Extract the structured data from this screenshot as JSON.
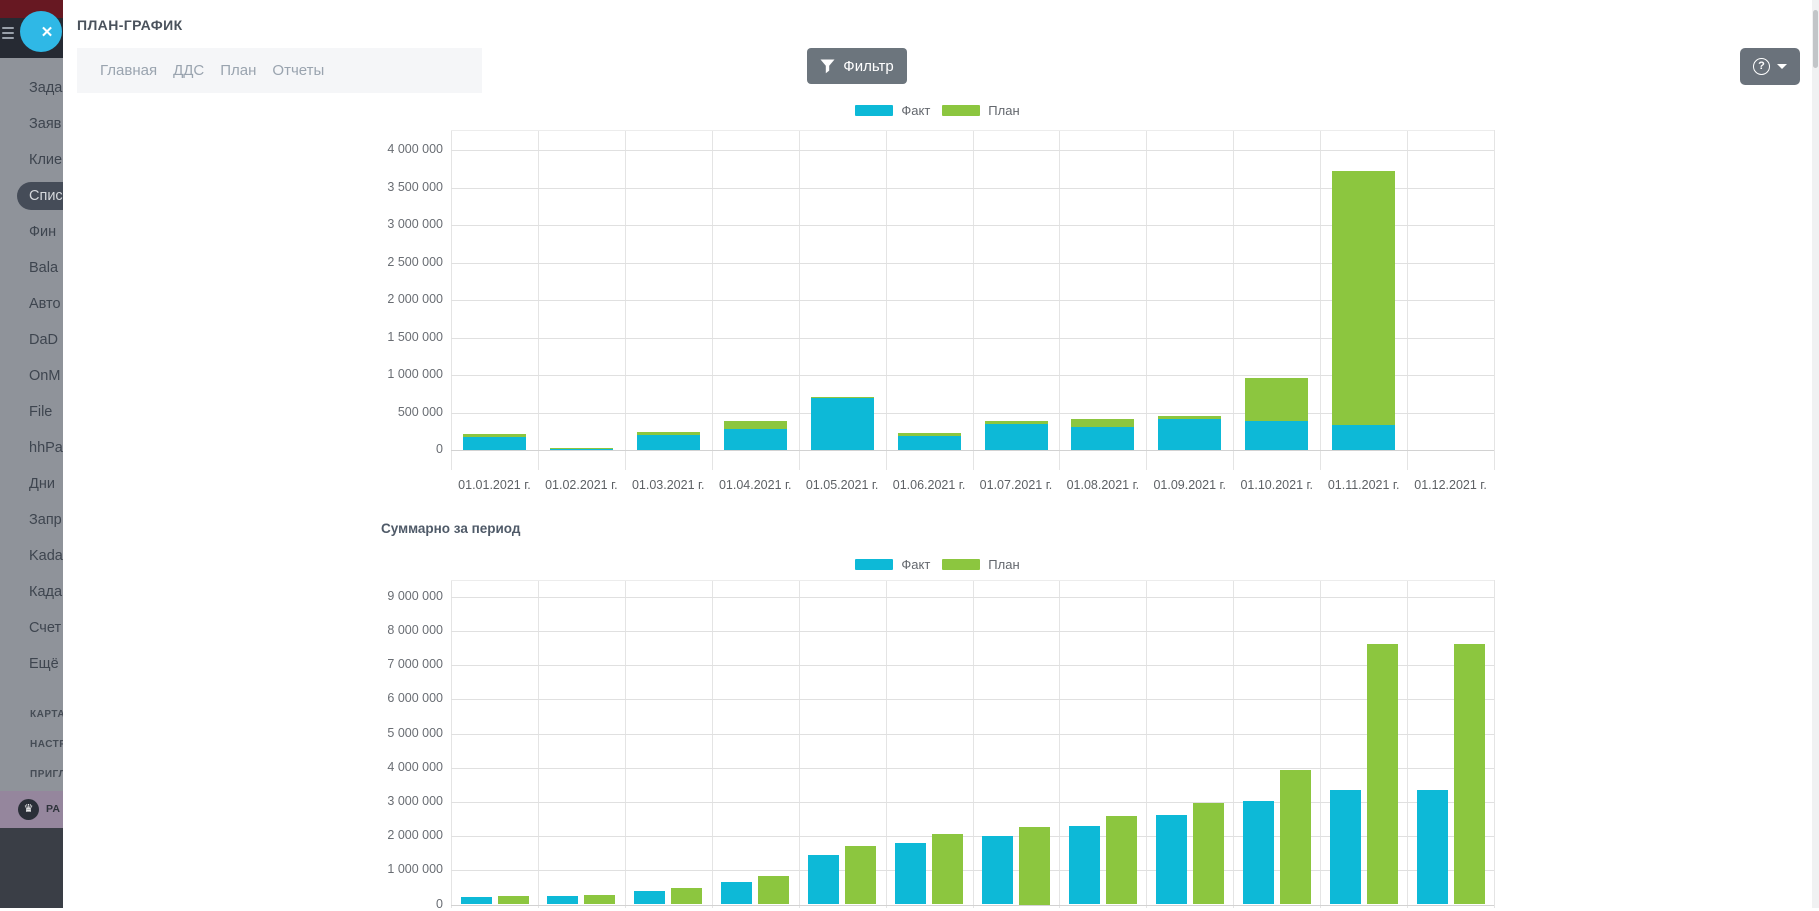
{
  "overlay_panel": {
    "title": "ПЛАН-ГРАФИК",
    "tabs": [
      {
        "label": "Главная"
      },
      {
        "label": "ДДС"
      },
      {
        "label": "План"
      },
      {
        "label": "Отчеты"
      }
    ],
    "filter_button_label": "Фильтр",
    "close_icon": "✕",
    "help_icon_text": "?"
  },
  "sidebar": {
    "menu_items": [
      "Зада",
      "Заяв",
      "Клие",
      "Спис",
      "Фин",
      "Bala",
      "Авто",
      "DaD",
      "OnM",
      "File",
      "hhPa",
      "Дни",
      "Запр",
      "Kada",
      "Када",
      "Счет",
      "Ещё"
    ],
    "active_item": "Спис",
    "section_items": [
      "КАРТА",
      "НАСТР",
      "ПРИГЛ"
    ],
    "upgrade_item": {
      "icon": "crown-icon",
      "icon_glyph": "♛",
      "label": "РА"
    }
  },
  "colors": {
    "fact": "#0db9d7",
    "plan": "#8cc63f",
    "close_button": "#2fb8e6",
    "gray_button": "#6c757d",
    "active_pill": "#454c58",
    "upgrade_row": "#95869d"
  },
  "chart_data": [
    {
      "type": "bar",
      "layout": "overlapped",
      "title": "",
      "legend": [
        "Факт",
        "План"
      ],
      "legend_position": "top",
      "grid": true,
      "ylim": [
        0,
        4000000
      ],
      "ytick_interval": 500000,
      "categories": [
        "01.01.2021 г.",
        "01.02.2021 г.",
        "01.03.2021 г.",
        "01.04.2021 г.",
        "01.05.2021 г.",
        "01.06.2021 г.",
        "01.07.2021 г.",
        "01.08.2021 г.",
        "01.09.2021 г.",
        "01.10.2021 г.",
        "01.11.2021 г.",
        "01.12.2021 г."
      ],
      "series": [
        {
          "name": "Факт",
          "color": "#0db9d7",
          "values": [
            180000,
            18000,
            205000,
            278000,
            700000,
            192000,
            352000,
            302000,
            413000,
            391000,
            333000,
            0
          ]
        },
        {
          "name": "План",
          "color": "#8cc63f",
          "values": [
            215000,
            32000,
            235000,
            382000,
            712000,
            228000,
            388000,
            410000,
            455000,
            964000,
            3720000,
            0
          ]
        }
      ]
    },
    {
      "type": "bar",
      "layout": "grouped",
      "title": "Суммарно за период",
      "legend": [
        "Факт",
        "План"
      ],
      "legend_position": "top",
      "grid": true,
      "ylim": [
        0,
        9000000
      ],
      "ytick_interval": 1000000,
      "x_axis_labels_visible": false,
      "categories": [
        "01.01.2021 г.",
        "01.02.2021 г.",
        "01.03.2021 г.",
        "01.04.2021 г.",
        "01.05.2021 г.",
        "01.06.2021 г.",
        "01.07.2021 г.",
        "01.08.2021 г.",
        "01.09.2021 г.",
        "01.10.2021 г.",
        "01.11.2021 г.",
        "01.12.2021 г."
      ],
      "series": [
        {
          "name": "Факт",
          "color": "#0db9d7",
          "values": [
            210000,
            240000,
            390000,
            670000,
            1450000,
            1800000,
            2000000,
            2300000,
            2620000,
            3030000,
            3350000,
            3350000
          ]
        },
        {
          "name": "План",
          "color": "#8cc63f",
          "values": [
            255000,
            290000,
            480000,
            830000,
            1700000,
            2050000,
            2280000,
            2600000,
            2980000,
            3920000,
            7630000,
            7630000
          ]
        }
      ]
    }
  ]
}
